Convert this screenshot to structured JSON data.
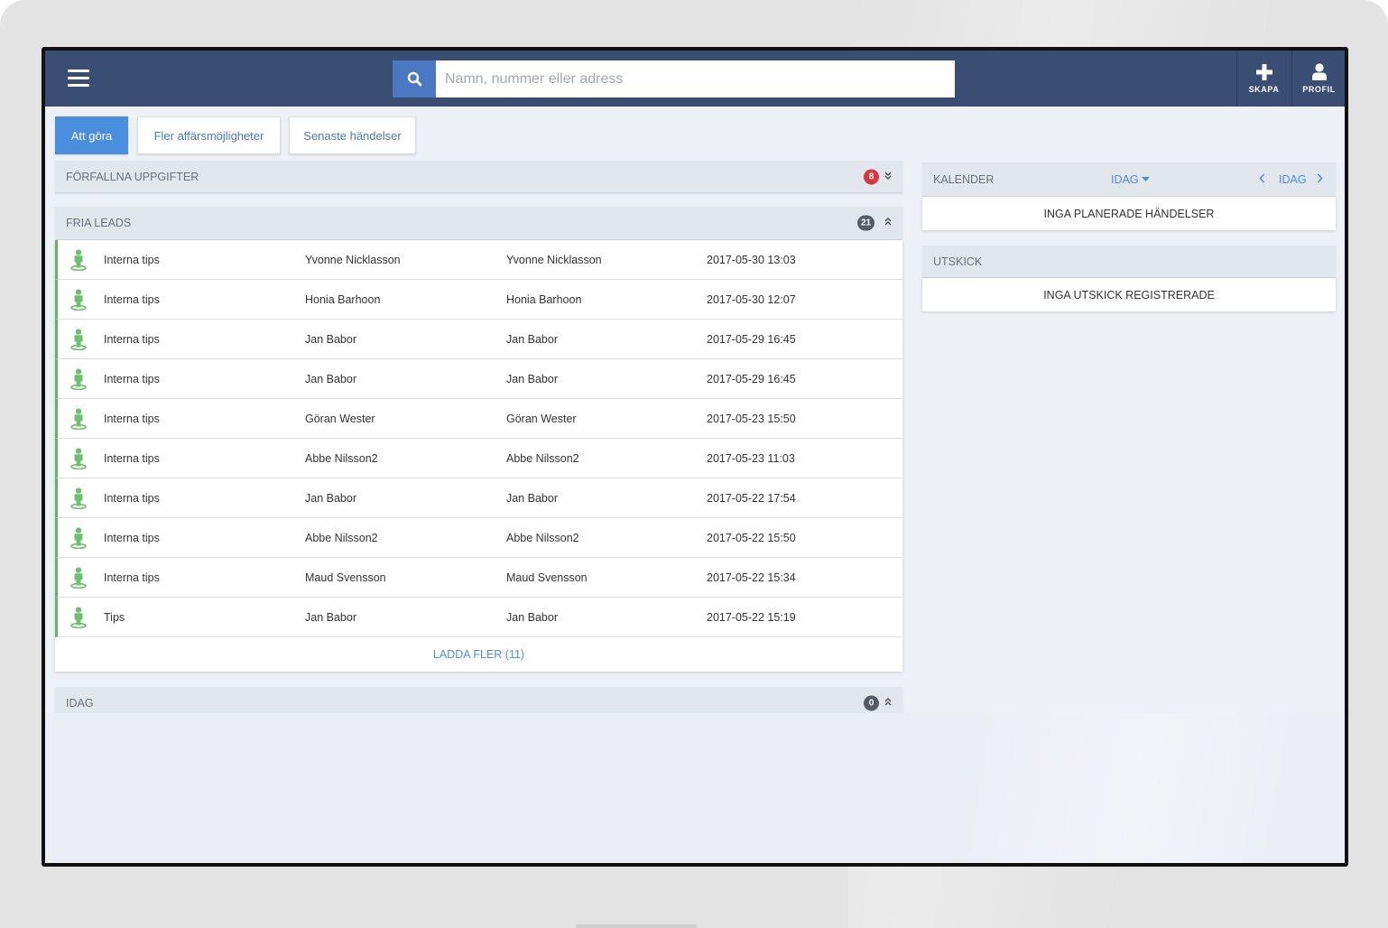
{
  "search": {
    "placeholder": "Namn, nummer eller adress"
  },
  "top_actions": {
    "create": "SKAPA",
    "profile": "PROFIL"
  },
  "tabs": [
    {
      "label": "Att göra",
      "active": true
    },
    {
      "label": "Fler affärsmöjligheter",
      "active": false
    },
    {
      "label": "Senaste händelser",
      "active": false
    }
  ],
  "overdue": {
    "title": "FÖRFALLNA UPPGIFTER",
    "count": "8",
    "badge_color": "#d9363e"
  },
  "free_leads": {
    "title": "FRIA LEADS",
    "count": "21",
    "badge_color": "#555b63",
    "rows": [
      {
        "source": "Interna tips",
        "name1": "Yvonne Nicklasson",
        "name2": "Yvonne Nicklasson",
        "datetime": "2017-05-30 13:03"
      },
      {
        "source": "Interna tips",
        "name1": "Honia Barhoon",
        "name2": "Honia Barhoon",
        "datetime": "2017-05-30 12:07"
      },
      {
        "source": "Interna tips",
        "name1": "Jan Babor",
        "name2": "Jan Babor",
        "datetime": "2017-05-29 16:45"
      },
      {
        "source": "Interna tips",
        "name1": "Jan Babor",
        "name2": "Jan Babor",
        "datetime": "2017-05-29 16:45"
      },
      {
        "source": "Interna tips",
        "name1": "Göran Wester",
        "name2": "Göran Wester",
        "datetime": "2017-05-23 15:50"
      },
      {
        "source": "Interna tips",
        "name1": "Abbe Nilsson2",
        "name2": "Abbe Nilsson2",
        "datetime": "2017-05-23 11:03"
      },
      {
        "source": "Interna tips",
        "name1": "Jan Babor",
        "name2": "Jan Babor",
        "datetime": "2017-05-22 17:54"
      },
      {
        "source": "Interna tips",
        "name1": "Abbe Nilsson2",
        "name2": "Abbe Nilsson2",
        "datetime": "2017-05-22 15:50"
      },
      {
        "source": "Interna tips",
        "name1": "Maud Svensson",
        "name2": "Maud Svensson",
        "datetime": "2017-05-22 15:34"
      },
      {
        "source": "Tips",
        "name1": "Jan Babor",
        "name2": "Jan Babor",
        "datetime": "2017-05-22 15:19"
      }
    ],
    "load_more": "LADDA FLER (11)"
  },
  "today": {
    "title": "IDAG",
    "count": "0",
    "badge_color": "#555b63"
  },
  "calendar": {
    "title": "KALENDER",
    "dropdown_label": "IDAG",
    "nav_label": "IDAG",
    "empty_text": "INGA PLANERADE HÄNDELSER"
  },
  "mailings": {
    "title": "UTSKICK",
    "empty_text": "INGA UTSKICK REGISTRERADE"
  },
  "colors": {
    "topbar": "#3a4d73",
    "accent": "#4a8ee0",
    "lead_stripe": "#5cb85c",
    "lead_icon": "#6cc070"
  },
  "icons": {
    "menu": "hamburger-icon",
    "search": "search-icon",
    "create": "plus-icon",
    "profile": "user-icon",
    "lead": "person-pin-icon"
  }
}
